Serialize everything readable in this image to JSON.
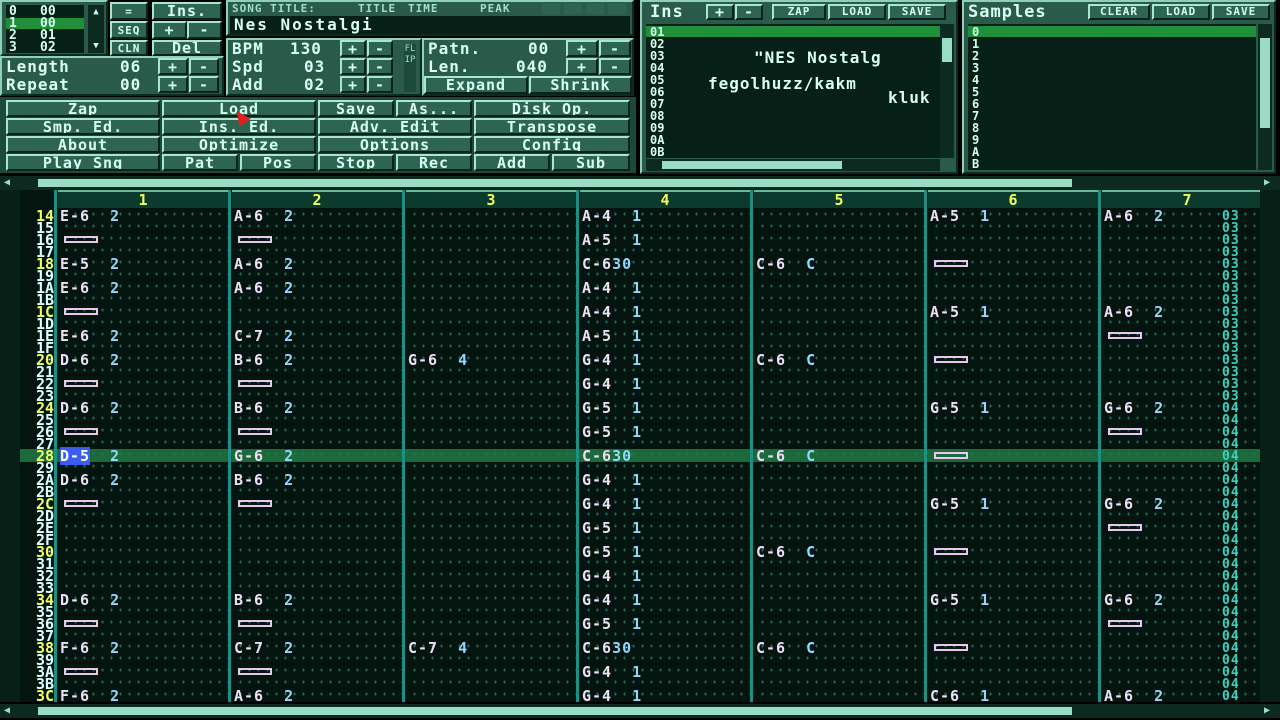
{
  "posed": {
    "rows": [
      [
        "0",
        "00"
      ],
      [
        "1",
        "00"
      ],
      [
        "2",
        "01"
      ],
      [
        "3",
        "02"
      ]
    ]
  },
  "song": {
    "title_label": "SONG TITLE:",
    "title": "Nes Nostalgi",
    "length_label": "Length",
    "length": "06",
    "repeat_label": "Repeat",
    "repeat": "00"
  },
  "topbtns": {
    "eq": "=",
    "seq": "SEQ",
    "cln": "CLN",
    "ins": "Ins.",
    "plus": "+",
    "minus": "-",
    "del": "Del"
  },
  "tabs": {
    "title": "TITLE",
    "time": "TIME",
    "peak": "PEAK"
  },
  "tempo": {
    "bpm_label": "BPM",
    "bpm": "130",
    "spd_label": "Spd",
    "spd": "03",
    "add_label": "Add",
    "add": "02",
    "flip": "FLIP"
  },
  "patt": {
    "patn_label": "Patn.",
    "patn": "00",
    "len_label": "Len.",
    "len": "040",
    "expand": "Expand",
    "shrink": "Shrink"
  },
  "menu": [
    [
      "Zap",
      "Load",
      "Save",
      "As...",
      "Disk Op."
    ],
    [
      "Smp. Ed.",
      "Ins. Ed.",
      "Adv. Edit",
      "Transpose"
    ],
    [
      "About",
      "Optimize",
      "Options",
      "Config"
    ],
    [
      "Play Sng",
      "Pat",
      "Pos",
      "Stop",
      "Rec",
      "Add",
      "Sub"
    ]
  ],
  "ins": {
    "title": "Ins",
    "zap": "ZAP",
    "load": "LOAD",
    "save": "SAVE",
    "rows": [
      "01",
      "02",
      "03",
      "04",
      "05",
      "06",
      "07",
      "08",
      "09",
      "0A",
      "0B"
    ],
    "text1": "\"NES Nostalg",
    "text2": "fegolhuzz/kakm",
    "text3": "kluk"
  },
  "samples": {
    "title": "Samples",
    "clear": "CLEAR",
    "load": "LOAD",
    "save": "SAVE",
    "rows": [
      "0",
      "1",
      "2",
      "3",
      "4",
      "5",
      "6",
      "7",
      "8",
      "9",
      "A",
      "B"
    ]
  },
  "pattern": {
    "channels": [
      "1",
      "2",
      "3",
      "4",
      "5",
      "6",
      "7"
    ],
    "rows": [
      "14",
      "15",
      "16",
      "17",
      "18",
      "19",
      "1A",
      "1B",
      "1C",
      "1D",
      "1E",
      "1F",
      "20",
      "21",
      "22",
      "23",
      "24",
      "25",
      "26",
      "27",
      "28",
      "29",
      "2A",
      "2B",
      "2C",
      "2D",
      "2E",
      "2F",
      "30",
      "31",
      "32",
      "33",
      "34",
      "35",
      "36",
      "37",
      "38",
      "39",
      "3A",
      "3B",
      "3C"
    ],
    "current_row": "28",
    "vol": [
      "03",
      "03",
      "03",
      "03",
      "03",
      "03",
      "03",
      "03",
      "03",
      "03",
      "03",
      "03",
      "03",
      "03",
      "03",
      "03",
      "04",
      "04",
      "04",
      "04",
      "04",
      "04",
      "04",
      "04",
      "04",
      "04",
      "04",
      "04",
      "04",
      "04",
      "04",
      "04",
      "04",
      "04",
      "04",
      "04",
      "04",
      "04",
      "04",
      "04",
      "04"
    ],
    "notes": [
      {
        "r": 0,
        "c": 0,
        "n": "E-6",
        "i": "2"
      },
      {
        "r": 0,
        "c": 1,
        "n": "A-6",
        "i": "2"
      },
      {
        "r": 0,
        "c": 3,
        "n": "A-4",
        "i": "1"
      },
      {
        "r": 0,
        "c": 5,
        "n": "A-5",
        "i": "1"
      },
      {
        "r": 0,
        "c": 6,
        "n": "A-6",
        "i": "2"
      },
      {
        "r": 2,
        "c": 3,
        "n": "A-5",
        "i": "1"
      },
      {
        "r": 4,
        "c": 0,
        "n": "E-5",
        "i": "2"
      },
      {
        "r": 4,
        "c": 1,
        "n": "A-6",
        "i": "2"
      },
      {
        "r": 4,
        "c": 3,
        "n": "C-6",
        "i": "30"
      },
      {
        "r": 4,
        "c": 4,
        "n": "C-6",
        "i": "C"
      },
      {
        "r": 6,
        "c": 0,
        "n": "E-6",
        "i": "2"
      },
      {
        "r": 6,
        "c": 1,
        "n": "A-6",
        "i": "2"
      },
      {
        "r": 6,
        "c": 3,
        "n": "A-4",
        "i": "1"
      },
      {
        "r": 8,
        "c": 3,
        "n": "A-4",
        "i": "1"
      },
      {
        "r": 8,
        "c": 5,
        "n": "A-5",
        "i": "1"
      },
      {
        "r": 8,
        "c": 6,
        "n": "A-6",
        "i": "2"
      },
      {
        "r": 10,
        "c": 0,
        "n": "E-6",
        "i": "2"
      },
      {
        "r": 10,
        "c": 1,
        "n": "C-7",
        "i": "2"
      },
      {
        "r": 10,
        "c": 3,
        "n": "A-5",
        "i": "1"
      },
      {
        "r": 12,
        "c": 0,
        "n": "D-6",
        "i": "2"
      },
      {
        "r": 12,
        "c": 1,
        "n": "B-6",
        "i": "2"
      },
      {
        "r": 12,
        "c": 2,
        "n": "G-6",
        "i": "4"
      },
      {
        "r": 12,
        "c": 3,
        "n": "G-4",
        "i": "1"
      },
      {
        "r": 12,
        "c": 4,
        "n": "C-6",
        "i": "C"
      },
      {
        "r": 14,
        "c": 3,
        "n": "G-4",
        "i": "1"
      },
      {
        "r": 16,
        "c": 0,
        "n": "D-6",
        "i": "2"
      },
      {
        "r": 16,
        "c": 1,
        "n": "B-6",
        "i": "2"
      },
      {
        "r": 16,
        "c": 3,
        "n": "G-5",
        "i": "1"
      },
      {
        "r": 16,
        "c": 5,
        "n": "G-5",
        "i": "1"
      },
      {
        "r": 16,
        "c": 6,
        "n": "G-6",
        "i": "2"
      },
      {
        "r": 18,
        "c": 3,
        "n": "G-5",
        "i": "1"
      },
      {
        "r": 20,
        "c": 0,
        "n": "D-5",
        "i": "2"
      },
      {
        "r": 20,
        "c": 1,
        "n": "G-6",
        "i": "2"
      },
      {
        "r": 20,
        "c": 3,
        "n": "C-6",
        "i": "30"
      },
      {
        "r": 20,
        "c": 4,
        "n": "C-6",
        "i": "C"
      },
      {
        "r": 22,
        "c": 0,
        "n": "D-6",
        "i": "2"
      },
      {
        "r": 22,
        "c": 1,
        "n": "B-6",
        "i": "2"
      },
      {
        "r": 22,
        "c": 3,
        "n": "G-4",
        "i": "1"
      },
      {
        "r": 24,
        "c": 3,
        "n": "G-4",
        "i": "1"
      },
      {
        "r": 24,
        "c": 5,
        "n": "G-5",
        "i": "1"
      },
      {
        "r": 24,
        "c": 6,
        "n": "G-6",
        "i": "2"
      },
      {
        "r": 26,
        "c": 3,
        "n": "G-5",
        "i": "1"
      },
      {
        "r": 28,
        "c": 3,
        "n": "G-5",
        "i": "1"
      },
      {
        "r": 28,
        "c": 4,
        "n": "C-6",
        "i": "C"
      },
      {
        "r": 30,
        "c": 3,
        "n": "G-4",
        "i": "1"
      },
      {
        "r": 32,
        "c": 0,
        "n": "D-6",
        "i": "2"
      },
      {
        "r": 32,
        "c": 1,
        "n": "B-6",
        "i": "2"
      },
      {
        "r": 32,
        "c": 3,
        "n": "G-4",
        "i": "1"
      },
      {
        "r": 32,
        "c": 5,
        "n": "G-5",
        "i": "1"
      },
      {
        "r": 32,
        "c": 6,
        "n": "G-6",
        "i": "2"
      },
      {
        "r": 34,
        "c": 3,
        "n": "G-5",
        "i": "1"
      },
      {
        "r": 36,
        "c": 0,
        "n": "F-6",
        "i": "2"
      },
      {
        "r": 36,
        "c": 1,
        "n": "C-7",
        "i": "2"
      },
      {
        "r": 36,
        "c": 2,
        "n": "C-7",
        "i": "4"
      },
      {
        "r": 36,
        "c": 3,
        "n": "C-6",
        "i": "30"
      },
      {
        "r": 36,
        "c": 4,
        "n": "C-6",
        "i": "C"
      },
      {
        "r": 38,
        "c": 3,
        "n": "G-4",
        "i": "1"
      },
      {
        "r": 40,
        "c": 0,
        "n": "F-6",
        "i": "2"
      },
      {
        "r": 40,
        "c": 1,
        "n": "A-6",
        "i": "2"
      },
      {
        "r": 40,
        "c": 3,
        "n": "G-4",
        "i": "1"
      },
      {
        "r": 40,
        "c": 5,
        "n": "C-6",
        "i": "1"
      },
      {
        "r": 40,
        "c": 6,
        "n": "A-6",
        "i": "2"
      }
    ],
    "rests": [
      [
        2,
        0
      ],
      [
        2,
        1
      ],
      [
        4,
        5
      ],
      [
        8,
        0
      ],
      [
        10,
        6
      ],
      [
        12,
        5
      ],
      [
        14,
        0
      ],
      [
        14,
        1
      ],
      [
        18,
        0
      ],
      [
        18,
        1
      ],
      [
        18,
        6
      ],
      [
        20,
        5
      ],
      [
        24,
        0
      ],
      [
        24,
        1
      ],
      [
        26,
        6
      ],
      [
        28,
        5
      ],
      [
        34,
        0
      ],
      [
        34,
        1
      ],
      [
        34,
        6
      ],
      [
        36,
        5
      ],
      [
        38,
        0
      ],
      [
        38,
        1
      ]
    ]
  }
}
